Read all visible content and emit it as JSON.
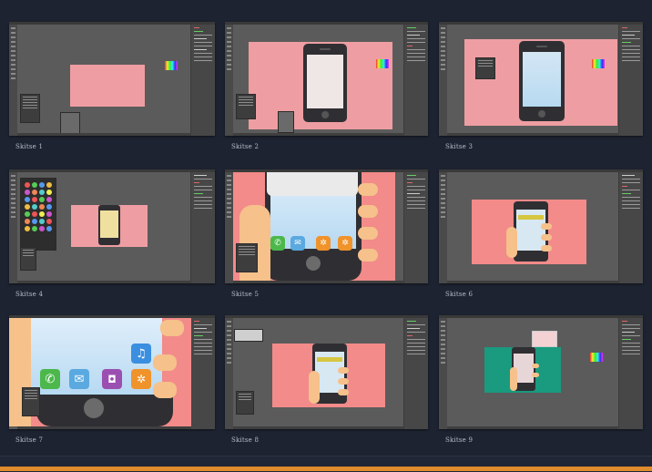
{
  "captions": [
    "Skitse 1",
    "Skitse 2",
    "Skitse 3",
    "Skitse 4",
    "Skitse 5",
    "Skitse 6",
    "Skitse 7",
    "Skitse 8",
    "Skitse 9"
  ],
  "colors": {
    "background": "#1d2331",
    "canvas_gray": "#5b5b5b",
    "pink": "#ee9ea2",
    "salmon": "#f28b89",
    "sky": "#bfe0f3",
    "skin": "#f6c18b",
    "teal": "#1a9a7e",
    "accent_bar": "#e08b2c"
  },
  "icons": [
    "phone-icon",
    "mail-icon",
    "camera-icon",
    "settings-icon",
    "music-icon"
  ]
}
